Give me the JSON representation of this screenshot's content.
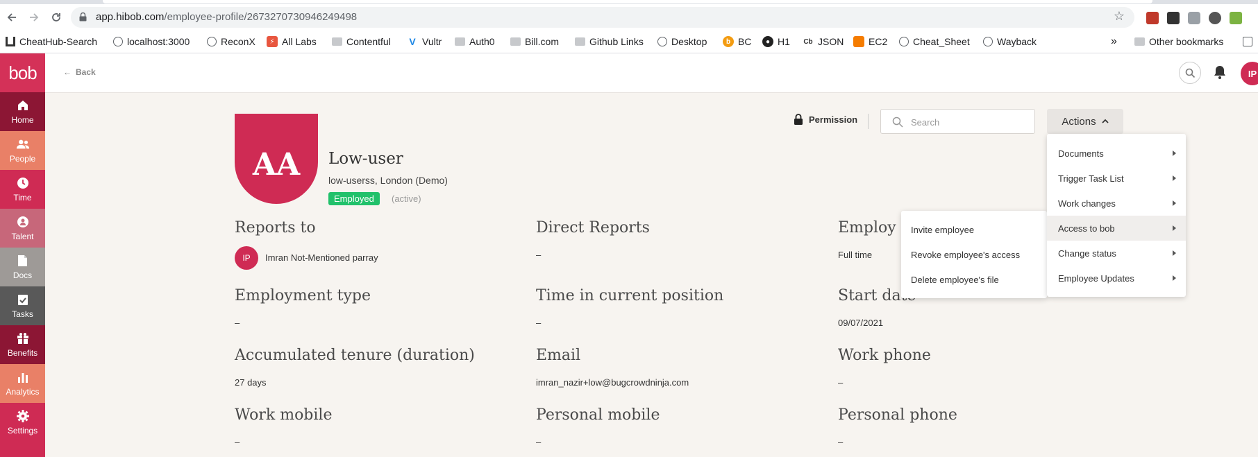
{
  "browser": {
    "url_host": "app.hibob.com",
    "url_path": "/employee-profile/2673270730946249498",
    "bookmarks": [
      {
        "label": "CheatHub-Search"
      },
      {
        "label": "localhost:3000"
      },
      {
        "label": "ReconX"
      },
      {
        "label": "All Labs"
      },
      {
        "label": "Contentful"
      },
      {
        "label": "Vultr"
      },
      {
        "label": "Auth0"
      },
      {
        "label": "Bill.com"
      },
      {
        "label": "Github Links"
      },
      {
        "label": "Desktop"
      },
      {
        "label": "BC"
      },
      {
        "label": "H1"
      },
      {
        "label": "JSON"
      },
      {
        "label": "EC2"
      },
      {
        "label": "Cheat_Sheet"
      },
      {
        "label": "Wayback"
      }
    ],
    "more_bookmarks": "»",
    "other_bookmarks": "Other bookmarks"
  },
  "sidebar": {
    "logo": "bob",
    "items": [
      {
        "label": "Home",
        "icon": "home-icon"
      },
      {
        "label": "People",
        "icon": "people-icon"
      },
      {
        "label": "Time",
        "icon": "clock-icon"
      },
      {
        "label": "Talent",
        "icon": "talent-icon"
      },
      {
        "label": "Docs",
        "icon": "document-icon"
      },
      {
        "label": "Tasks",
        "icon": "tasks-icon"
      },
      {
        "label": "Benefits",
        "icon": "gift-icon"
      },
      {
        "label": "Analytics",
        "icon": "bar-chart-icon"
      },
      {
        "label": "Settings",
        "icon": "gear-icon"
      }
    ],
    "colors": {
      "primary": "#cf2b54",
      "dark": "#8c1634",
      "salmon": "#e98067"
    }
  },
  "header": {
    "back_label": "Back",
    "user_initials": "IP"
  },
  "actionbar": {
    "permission_label": "Permission",
    "search_placeholder": "Search",
    "actions_label": "Actions"
  },
  "profile": {
    "initials": "AA",
    "name": "Low-user",
    "subtitle": "low-userss, London (Demo)",
    "status": "Employed",
    "status_note": "(active)",
    "status_color": "#21c16b"
  },
  "fields": {
    "reports_to": {
      "label": "Reports to",
      "initials": "IP",
      "value": "Imran Not-Mentioned parray"
    },
    "direct_reports": {
      "label": "Direct Reports",
      "value": "–"
    },
    "employment": {
      "label": "Employ",
      "value": "Full time"
    },
    "employment_type": {
      "label": "Employment type",
      "value": "–"
    },
    "time_in_position": {
      "label": "Time in current position",
      "value": "–"
    },
    "start_date": {
      "label": "Start date",
      "value": "09/07/2021"
    },
    "accumulated_tenure": {
      "label": "Accumulated tenure (duration)",
      "value": "27 days"
    },
    "email": {
      "label": "Email",
      "value": "imran_nazir+low@bugcrowdninja.com"
    },
    "work_phone": {
      "label": "Work phone",
      "value": "–"
    },
    "work_mobile": {
      "label": "Work mobile",
      "value": "–"
    },
    "personal_mobile": {
      "label": "Personal mobile",
      "value": "–"
    },
    "personal_phone": {
      "label": "Personal phone",
      "value": "–"
    }
  },
  "actions_menu": {
    "items": [
      {
        "label": "Documents"
      },
      {
        "label": "Trigger Task List"
      },
      {
        "label": "Work changes"
      },
      {
        "label": "Access to bob"
      },
      {
        "label": "Change status"
      },
      {
        "label": "Employee Updates"
      }
    ],
    "submenu": [
      {
        "label": "Invite employee"
      },
      {
        "label": "Revoke employee's access"
      },
      {
        "label": "Delete employee's file"
      }
    ]
  }
}
